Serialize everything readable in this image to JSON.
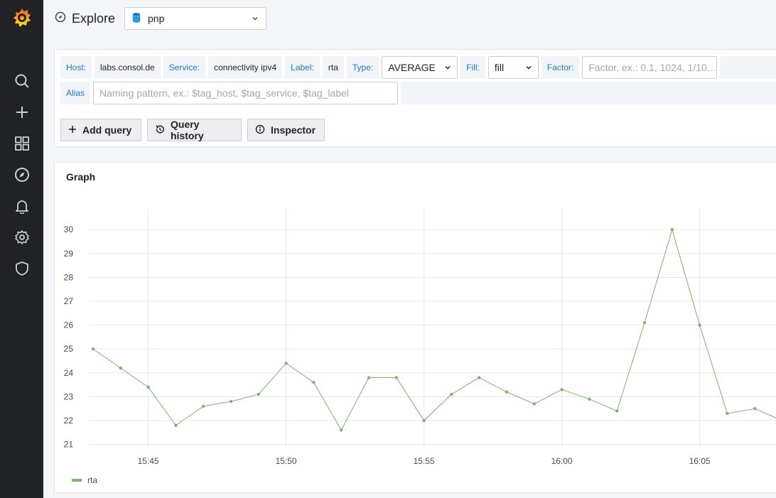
{
  "topbar": {
    "title": "Explore",
    "datasource": "pnp"
  },
  "query": {
    "host_label": "Host:",
    "host_value": "labs.consol.de",
    "service_label": "Service:",
    "service_value": "connectivity ipv4",
    "label_label": "Label:",
    "label_value": "rta",
    "type_label": "Type:",
    "type_value": "AVERAGE",
    "fill_label": "Fill:",
    "fill_value": "fill",
    "factor_label": "Factor:",
    "factor_placeholder": "Factor, ex.: 0.1, 1024, 1/10…",
    "alias_label": "Alias",
    "alias_placeholder": "Naming pattern, ex.: $tag_host, $tag_service, $tag_label"
  },
  "buttons": {
    "add_query": "Add query",
    "query_history": "Query history",
    "inspector": "Inspector"
  },
  "graph": {
    "title": "Graph"
  },
  "chart_data": {
    "type": "line",
    "x": [
      "15:43",
      "15:44",
      "15:45",
      "15:46",
      "15:47",
      "15:48",
      "15:49",
      "15:50",
      "15:51",
      "15:52",
      "15:53",
      "15:54",
      "15:55",
      "15:56",
      "15:57",
      "15:58",
      "15:59",
      "16:00",
      "16:01",
      "16:02",
      "16:03",
      "16:04",
      "16:05",
      "16:06",
      "16:07",
      "16:08"
    ],
    "series": [
      {
        "name": "rta",
        "color": "#7eb26d",
        "values": [
          25.0,
          24.2,
          23.4,
          21.8,
          22.6,
          22.8,
          23.1,
          24.4,
          23.6,
          21.6,
          23.8,
          23.8,
          22.0,
          23.1,
          23.8,
          23.2,
          22.7,
          23.3,
          22.9,
          22.4,
          26.1,
          30.0,
          26.0,
          22.3,
          22.5,
          22.0
        ]
      }
    ],
    "x_ticks": [
      "15:45",
      "15:50",
      "15:55",
      "16:00",
      "16:05"
    ],
    "y_ticks": [
      21,
      22,
      23,
      24,
      25,
      26,
      27,
      28,
      29,
      30
    ],
    "ylim": [
      20.9,
      30.9
    ],
    "grid": true,
    "legend": "bottom-left"
  },
  "colors": {
    "accent": "#1f78c1",
    "sidebar": "#202226",
    "series": "#7eb26d",
    "logo": "#f05a28"
  }
}
